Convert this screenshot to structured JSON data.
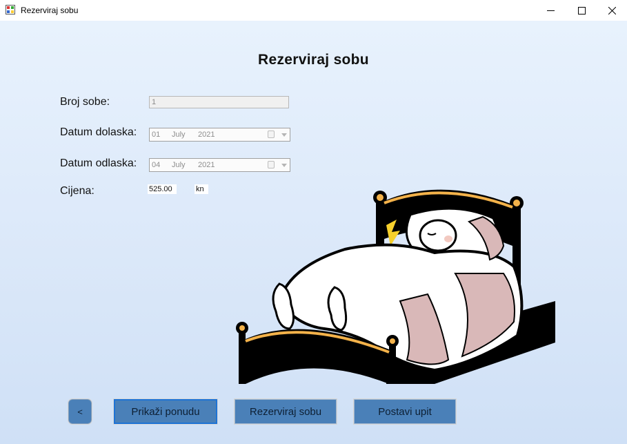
{
  "window": {
    "title": "Rezerviraj sobu"
  },
  "page": {
    "heading": "Rezerviraj sobu"
  },
  "form": {
    "room_label": "Broj sobe:",
    "room_value": "1",
    "arrival_label": "Datum dolaska:",
    "arrival": {
      "day": "01",
      "month": "July",
      "year": "2021"
    },
    "departure_label": "Datum odlaska:",
    "departure": {
      "day": "04",
      "month": "July",
      "year": "2021"
    },
    "price_label": "Cijena:",
    "price_value": "525.00",
    "currency": "kn"
  },
  "buttons": {
    "back": "<",
    "offer": "Prikaži ponudu",
    "reserve": "Rezerviraj sobu",
    "ask": "Postavi upit"
  },
  "colors": {
    "button_fill": "#4a80b8",
    "focus_border": "#1d73d6"
  }
}
